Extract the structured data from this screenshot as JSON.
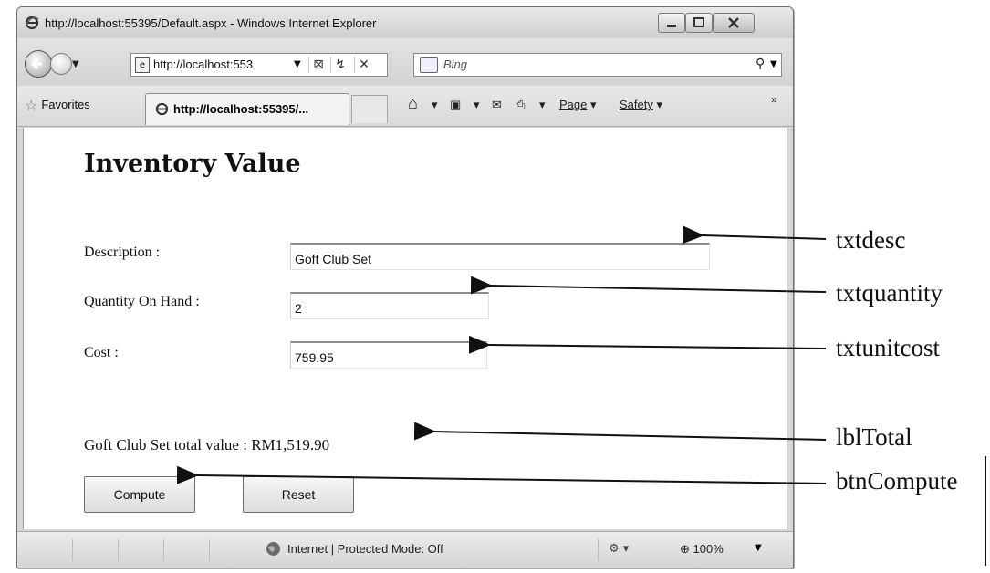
{
  "window": {
    "title": "http://localhost:55395/Default.aspx - Windows Internet Explorer"
  },
  "address_bar": {
    "url": "http://localhost:553",
    "search_placeholder": "Bing"
  },
  "favorites_bar": {
    "favorites_label": "Favorites",
    "tab_label": "http://localhost:55395/...",
    "page_menu": "Page",
    "safety_menu": "Safety",
    "overflow": "»"
  },
  "form": {
    "title": "Inventory Value",
    "description_label": "Description :",
    "description_value": "Goft Club Set",
    "quantity_label": "Quantity On Hand :",
    "quantity_value": "2",
    "cost_label": "Cost :",
    "cost_value": "759.95",
    "total_text": "Goft Club Set total value : RM1,519.90",
    "compute_button": "Compute",
    "reset_button": "Reset"
  },
  "status_bar": {
    "zone_text": "Internet | Protected Mode: Off",
    "zoom": "100%"
  },
  "annotations": {
    "txtdesc": "txtdesc",
    "txtquantity": "txtquantity",
    "txtunitcost": "txtunitcost",
    "lblTotal": "lblTotal",
    "btnCompute": "btnCompute"
  }
}
